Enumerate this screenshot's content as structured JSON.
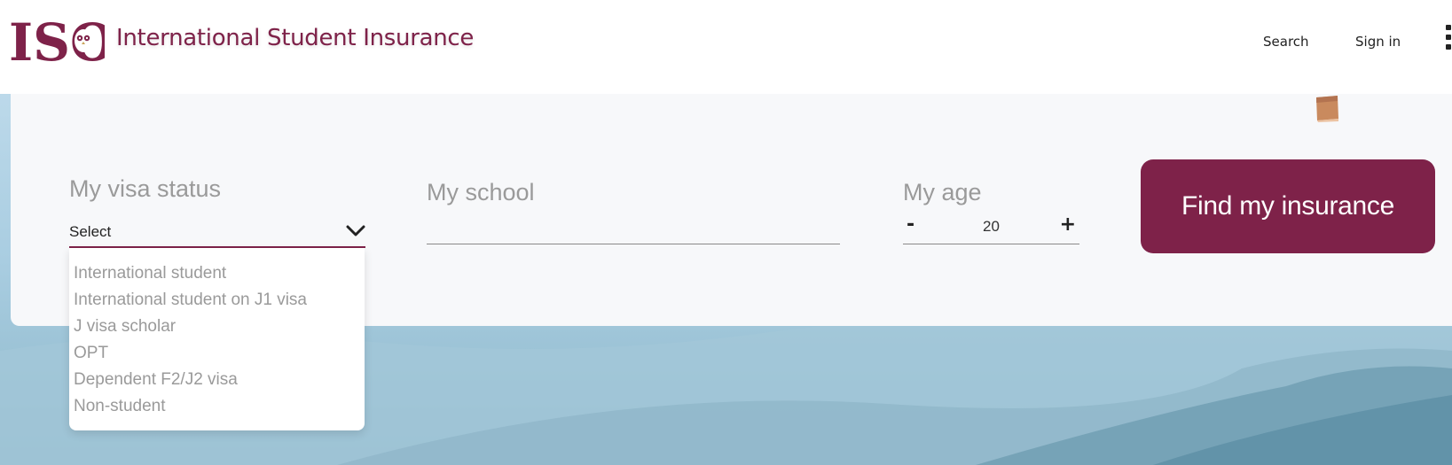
{
  "header": {
    "logo_text": "ISO",
    "brand_name": "International Student Insurance",
    "nav": {
      "search_label": "Search",
      "signin_label": "Sign in"
    }
  },
  "form": {
    "visa_label": "My visa status",
    "visa_value": "Select",
    "school_label": "My school",
    "school_value": "",
    "age_label": "My age",
    "age_minus": "-",
    "age_value": "20",
    "age_plus": "+",
    "find_button_label": "Find my insurance"
  },
  "dropdown": {
    "options": [
      "International student",
      "International student on J1 visa",
      "J visa scholar",
      "OPT",
      "Dependent F2/J2 visa",
      "Non-student"
    ]
  },
  "colors": {
    "brand": "#7e2249",
    "card_bg": "#f7f8fa",
    "muted_text": "#9a9a9a"
  },
  "icons": {
    "menu": "vertical-dots-icon",
    "chevron": "chevron-down-icon",
    "logo_owl": "owl-icon"
  }
}
